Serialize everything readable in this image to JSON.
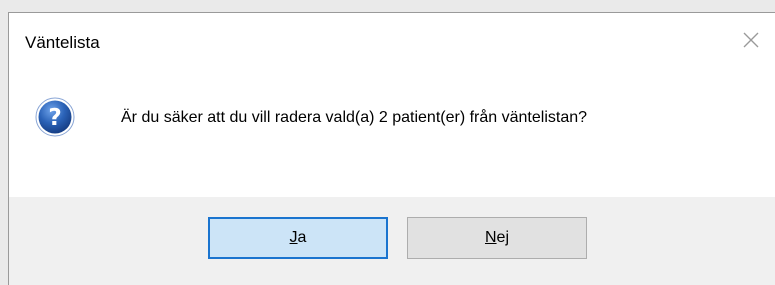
{
  "dialog": {
    "title": "Väntelista",
    "message": "Är du säker att du vill radera vald(a) 2 patient(er) från väntelistan?",
    "icon": "question-icon",
    "close_icon": "close-icon",
    "buttons": {
      "yes": {
        "accel": "J",
        "rest": "a"
      },
      "no": {
        "accel": "N",
        "rest": "ej"
      }
    }
  },
  "colors": {
    "default_button_border": "#1a74cf",
    "default_button_fill": "#cce4f7",
    "button_fill": "#e1e1e1",
    "footer_bg": "#f0f0f0",
    "icon_blue": "#2b63b8"
  }
}
